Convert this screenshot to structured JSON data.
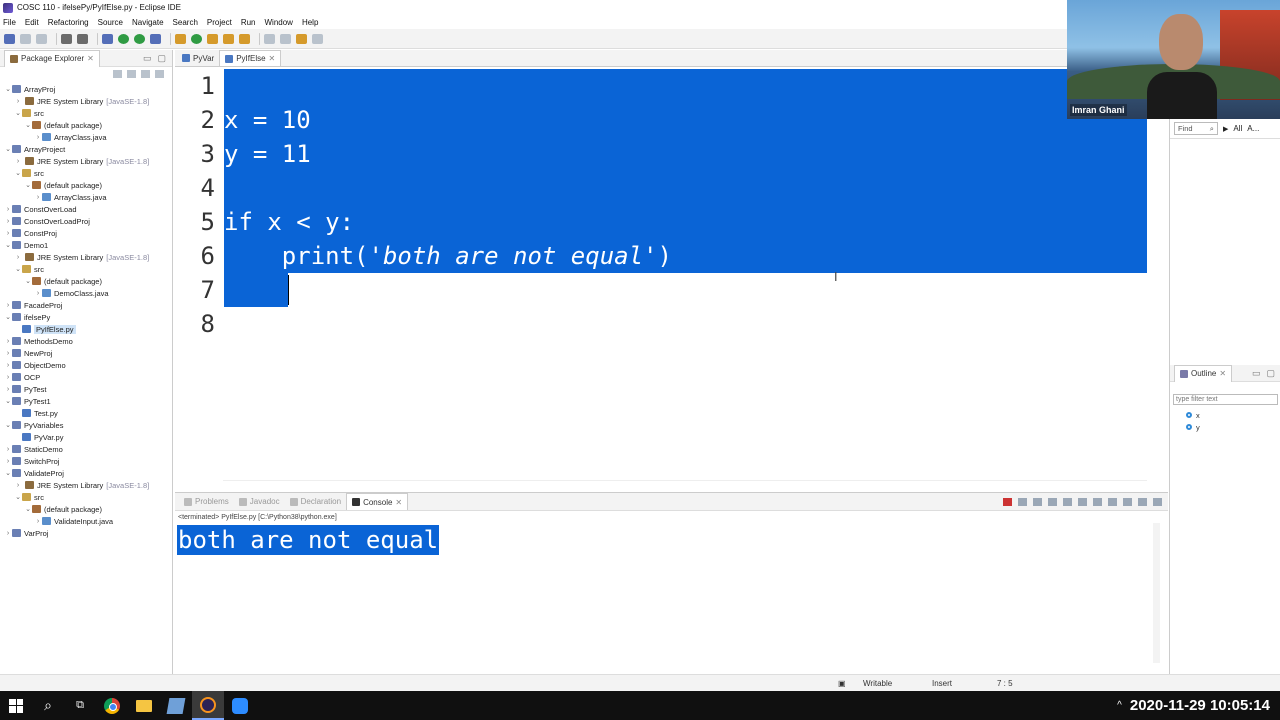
{
  "window": {
    "title": "COSC 110 - ifelsePy/PyIfElse.py - Eclipse IDE"
  },
  "menu": [
    "File",
    "Edit",
    "Refactoring",
    "Source",
    "Navigate",
    "Search",
    "Project",
    "Run",
    "Window",
    "Help"
  ],
  "package_explorer": {
    "tab_label": "Package Explorer",
    "tree": [
      {
        "depth": 0,
        "twisty": "⌄",
        "icon": "proj",
        "name": "ArrayProj"
      },
      {
        "depth": 1,
        "twisty": "›",
        "icon": "lib",
        "name": "JRE System Library",
        "suffix": "[JavaSE-1.8]"
      },
      {
        "depth": 1,
        "twisty": "⌄",
        "icon": "src",
        "name": "src"
      },
      {
        "depth": 2,
        "twisty": "⌄",
        "icon": "pkg",
        "name": "(default package)"
      },
      {
        "depth": 3,
        "twisty": "›",
        "icon": "java",
        "name": "ArrayClass.java"
      },
      {
        "depth": 0,
        "twisty": "⌄",
        "icon": "proj",
        "name": "ArrayProject"
      },
      {
        "depth": 1,
        "twisty": "›",
        "icon": "lib",
        "name": "JRE System Library",
        "suffix": "[JavaSE-1.8]"
      },
      {
        "depth": 1,
        "twisty": "⌄",
        "icon": "src",
        "name": "src"
      },
      {
        "depth": 2,
        "twisty": "⌄",
        "icon": "pkg",
        "name": "(default package)"
      },
      {
        "depth": 3,
        "twisty": "›",
        "icon": "java",
        "name": "ArrayClass.java"
      },
      {
        "depth": 0,
        "twisty": "›",
        "icon": "proj",
        "name": "ConstOverLoad"
      },
      {
        "depth": 0,
        "twisty": "›",
        "icon": "proj",
        "name": "ConstOverLoadProj"
      },
      {
        "depth": 0,
        "twisty": "›",
        "icon": "proj",
        "name": "ConstProj"
      },
      {
        "depth": 0,
        "twisty": "⌄",
        "icon": "proj",
        "name": "Demo1"
      },
      {
        "depth": 1,
        "twisty": "›",
        "icon": "lib",
        "name": "JRE System Library",
        "suffix": "[JavaSE-1.8]"
      },
      {
        "depth": 1,
        "twisty": "⌄",
        "icon": "src",
        "name": "src"
      },
      {
        "depth": 2,
        "twisty": "⌄",
        "icon": "pkg",
        "name": "(default package)"
      },
      {
        "depth": 3,
        "twisty": "›",
        "icon": "java",
        "name": "DemoClass.java"
      },
      {
        "depth": 0,
        "twisty": "›",
        "icon": "proj",
        "name": "FacadeProj"
      },
      {
        "depth": 0,
        "twisty": "⌄",
        "icon": "proj",
        "name": "ifelsePy"
      },
      {
        "depth": 1,
        "twisty": "",
        "icon": "py",
        "name": "PyIfElse.py",
        "selected": true
      },
      {
        "depth": 0,
        "twisty": "›",
        "icon": "proj",
        "name": "MethodsDemo"
      },
      {
        "depth": 0,
        "twisty": "›",
        "icon": "proj",
        "name": "NewProj"
      },
      {
        "depth": 0,
        "twisty": "›",
        "icon": "proj",
        "name": "ObjectDemo"
      },
      {
        "depth": 0,
        "twisty": "›",
        "icon": "proj",
        "name": "OCP"
      },
      {
        "depth": 0,
        "twisty": "›",
        "icon": "proj",
        "name": "PyTest"
      },
      {
        "depth": 0,
        "twisty": "⌄",
        "icon": "proj",
        "name": "PyTest1"
      },
      {
        "depth": 1,
        "twisty": "",
        "icon": "py",
        "name": "Test.py"
      },
      {
        "depth": 0,
        "twisty": "⌄",
        "icon": "proj",
        "name": "PyVariables"
      },
      {
        "depth": 1,
        "twisty": "",
        "icon": "py",
        "name": "PyVar.py"
      },
      {
        "depth": 0,
        "twisty": "›",
        "icon": "proj",
        "name": "StaticDemo"
      },
      {
        "depth": 0,
        "twisty": "›",
        "icon": "proj",
        "name": "SwitchProj"
      },
      {
        "depth": 0,
        "twisty": "⌄",
        "icon": "proj",
        "name": "ValidateProj"
      },
      {
        "depth": 1,
        "twisty": "›",
        "icon": "lib",
        "name": "JRE System Library",
        "suffix": "[JavaSE-1.8]"
      },
      {
        "depth": 1,
        "twisty": "⌄",
        "icon": "src",
        "name": "src"
      },
      {
        "depth": 2,
        "twisty": "⌄",
        "icon": "pkg",
        "name": "(default package)"
      },
      {
        "depth": 3,
        "twisty": "›",
        "icon": "java",
        "name": "ValidateInput.java"
      },
      {
        "depth": 0,
        "twisty": "›",
        "icon": "proj",
        "name": "VarProj"
      }
    ]
  },
  "editor": {
    "tabs": [
      {
        "label": "PyVar",
        "active": false
      },
      {
        "label": "PyIfElse",
        "active": true
      }
    ],
    "lines": [
      {
        "n": "1",
        "pre": "",
        "code": "",
        "str": "",
        "post": ""
      },
      {
        "n": "2",
        "pre": "",
        "code": "x = 10",
        "str": "",
        "post": ""
      },
      {
        "n": "3",
        "pre": "",
        "code": "y = 11",
        "str": "",
        "post": ""
      },
      {
        "n": "4",
        "pre": "",
        "code": "",
        "str": "",
        "post": ""
      },
      {
        "n": "5",
        "pre": "",
        "code": "if x < y:",
        "str": "",
        "post": ""
      },
      {
        "n": "6",
        "pre": "    ",
        "code": "print(",
        "str": "'both are not equal'",
        "post": ")"
      },
      {
        "n": "7",
        "pre": "    ",
        "code": "",
        "str": "",
        "post": ""
      },
      {
        "n": "8",
        "pre": "",
        "code": "",
        "str": "",
        "post": ""
      }
    ]
  },
  "webcam": {
    "name": "Imran Ghani"
  },
  "find": {
    "label": "Find",
    "all": "All",
    "more": "A..."
  },
  "outline": {
    "tab_label": "Outline",
    "filter_placeholder": "type filter text",
    "items": [
      "x",
      "y"
    ]
  },
  "console": {
    "tabs": [
      {
        "label": "Problems",
        "active": false
      },
      {
        "label": "Javadoc",
        "active": false
      },
      {
        "label": "Declaration",
        "active": false
      },
      {
        "label": "Console",
        "active": true
      }
    ],
    "terminated": "<terminated> PyIfElse.py [C:\\Python38\\python.exe]",
    "output": "both are not equal"
  },
  "status": {
    "mode": "Writable",
    "insert": "Insert",
    "position": "7 : 5"
  },
  "taskbar": {
    "clock": "2020-11-29  10:05:14"
  },
  "colors": {
    "selection": "#0a64d6"
  }
}
